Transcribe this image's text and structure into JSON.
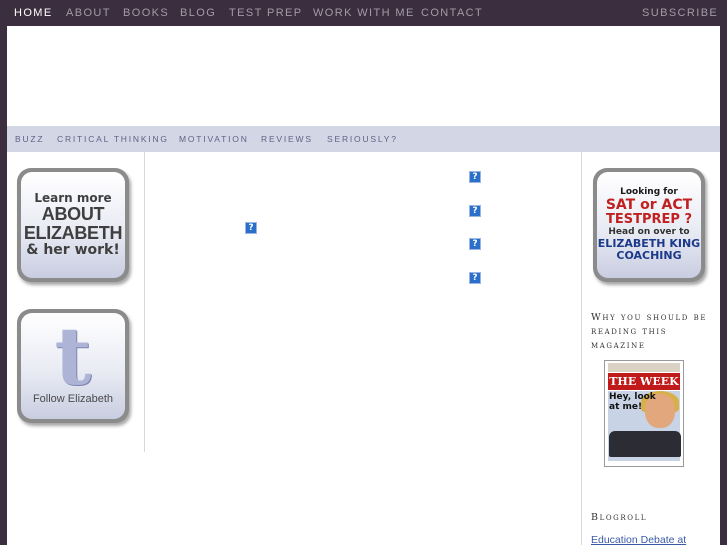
{
  "top_nav": {
    "items": [
      {
        "label": "HOME",
        "active": true
      },
      {
        "label": "ABOUT"
      },
      {
        "label": "BOOKS"
      },
      {
        "label": "BLOG"
      },
      {
        "label": "TEST PREP"
      },
      {
        "label": "WORK WITH ME"
      },
      {
        "label": "CONTACT"
      }
    ],
    "subscribe": "SUBSCRIBE"
  },
  "sub_nav": {
    "items": [
      "BUZZ",
      "CRITICAL THINKING",
      "MOTIVATION",
      "REVIEWS",
      "SERIOUSLY?"
    ]
  },
  "left_sidebar": {
    "about_badge": {
      "line1": "Learn more",
      "line2": "ABOUT",
      "line3": "ELIZABETH",
      "line4": "& her work!"
    },
    "twitter_badge": {
      "glyph": "t",
      "label": "Follow Elizabeth"
    }
  },
  "main": {
    "broken_images": [
      "?",
      "?",
      "?",
      "?",
      "?"
    ]
  },
  "right_sidebar": {
    "testprep_badge": {
      "line1": "Looking for",
      "line2": "SAT or ACT",
      "line3": "TESTPREP ?",
      "line4": "Head on over to",
      "line5": "ELIZABETH KING",
      "line6": "COACHING"
    },
    "magazine_widget": {
      "title_line1": "Why you should be",
      "title_line2": "reading this",
      "title_line3": "magazine",
      "cover_masthead": "THE WEEK",
      "cover_headline_1": "Hey, look",
      "cover_headline_2": "at me!"
    },
    "blogroll": {
      "title": "Blogroll",
      "first_link": "Education Debate at"
    }
  },
  "colors": {
    "top_bar": "#3b2f3f",
    "subnav_bg": "#d3d6e5",
    "link_blue": "#3a5aa6"
  }
}
